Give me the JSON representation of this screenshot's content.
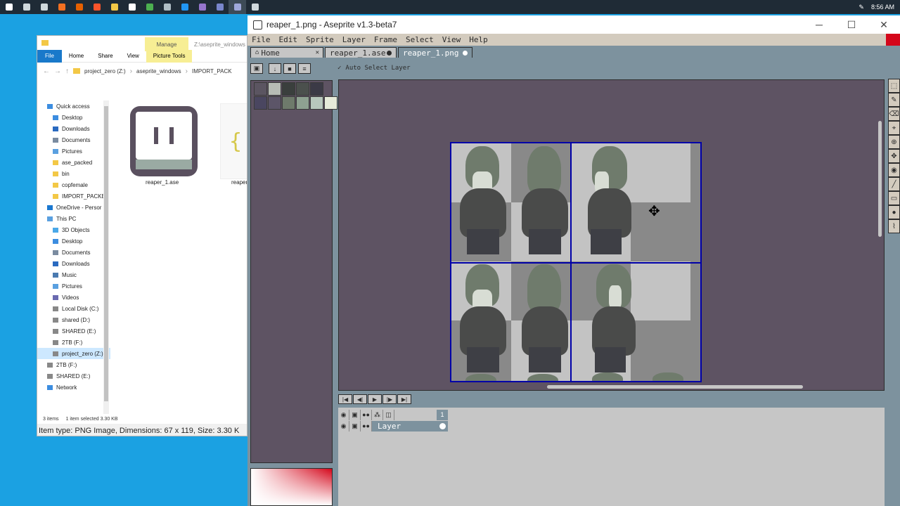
{
  "taskbar": {
    "icons": [
      "windows-icon",
      "search-icon",
      "taskview-icon",
      "search-app-icon",
      "firefox-icon",
      "brave-icon",
      "explorer-icon",
      "obs-icon",
      "app-icon",
      "app2-icon",
      "vscode-icon",
      "app3-icon",
      "app4-icon",
      "aseprite-icon",
      "app5-icon"
    ],
    "time": "8:56 AM"
  },
  "explorer": {
    "manage_label": "Manage",
    "path_small": "Z:\\aseprite_windows",
    "ribbon": {
      "file": "File",
      "home": "Home",
      "share": "Share",
      "view": "View",
      "picture_tools": "Picture Tools"
    },
    "address": {
      "drive": "project_zero (Z:)",
      "folder1": "aseprite_windows",
      "folder2": "IMPORT_PACK"
    },
    "nav": [
      {
        "label": "Quick access",
        "indent": 0,
        "color": "#3c8de0"
      },
      {
        "label": "Desktop",
        "indent": 1,
        "color": "#3c8de0"
      },
      {
        "label": "Downloads",
        "indent": 1,
        "color": "#2a6ac0"
      },
      {
        "label": "Documents",
        "indent": 1,
        "color": "#7a8ba0"
      },
      {
        "label": "Pictures",
        "indent": 1,
        "color": "#5aa0e0"
      },
      {
        "label": "ase_packed",
        "indent": 1,
        "color": "#f3c846"
      },
      {
        "label": "bin",
        "indent": 1,
        "color": "#f3c846"
      },
      {
        "label": "copfemale",
        "indent": 1,
        "color": "#f3c846"
      },
      {
        "label": "IMPORT_PACKE",
        "indent": 1,
        "color": "#f3c846"
      },
      {
        "label": "OneDrive - Persor",
        "indent": 0,
        "color": "#1b78d0"
      },
      {
        "label": "This PC",
        "indent": 0,
        "color": "#5aa0e0"
      },
      {
        "label": "3D Objects",
        "indent": 1,
        "color": "#4aa8e8"
      },
      {
        "label": "Desktop",
        "indent": 1,
        "color": "#3c8de0"
      },
      {
        "label": "Documents",
        "indent": 1,
        "color": "#7a8ba0"
      },
      {
        "label": "Downloads",
        "indent": 1,
        "color": "#2a6ac0"
      },
      {
        "label": "Music",
        "indent": 1,
        "color": "#4a7ab0"
      },
      {
        "label": "Pictures",
        "indent": 1,
        "color": "#5aa0e0"
      },
      {
        "label": "Videos",
        "indent": 1,
        "color": "#6a6ab0"
      },
      {
        "label": "Local Disk (C:)",
        "indent": 1,
        "color": "#888888"
      },
      {
        "label": "shared (D:)",
        "indent": 1,
        "color": "#888888"
      },
      {
        "label": "SHARED (E:)",
        "indent": 1,
        "color": "#888888"
      },
      {
        "label": "2TB (F:)",
        "indent": 1,
        "color": "#888888"
      },
      {
        "label": "project_zero (Z:)",
        "indent": 1,
        "color": "#888888",
        "selected": true
      },
      {
        "label": "2TB (F:)",
        "indent": 0,
        "color": "#888888"
      },
      {
        "label": "SHARED (E:)",
        "indent": 0,
        "color": "#888888"
      },
      {
        "label": "Network",
        "indent": 0,
        "color": "#3c8de0"
      }
    ],
    "files": [
      {
        "name": "reaper_1.ase"
      },
      {
        "name": "reaper"
      }
    ],
    "status": {
      "count": "3 items",
      "selected": "1 item selected  3.30 KB"
    },
    "item_type": "Item type: PNG Image, Dimensions: 67 x 119, Size: 3.30 K"
  },
  "aseprite": {
    "title": "reaper_1.png - Aseprite v1.3-beta7",
    "menu": [
      "File",
      "Edit",
      "Sprite",
      "Layer",
      "Frame",
      "Select",
      "View",
      "Help"
    ],
    "tabs": [
      {
        "label": "Home"
      },
      {
        "label": "reaper_1.ase"
      },
      {
        "label": "reaper_1.png"
      }
    ],
    "context": {
      "auto_select_label": "Auto Select Layer"
    },
    "palette": [
      "#5b5561",
      "#b7bcb5",
      "#3a3f3d",
      "#4b504d",
      "#3b3a46",
      "#4a4660",
      "#5c5568",
      "#6e7a6b",
      "#8ea191",
      "#b7c7bc",
      "#e6ebd9"
    ],
    "palette_marker": "II",
    "timeline": {
      "frame": "1",
      "layer": "Layer"
    },
    "tools": [
      "marquee-icon",
      "pencil-icon",
      "eraser-icon",
      "eyedropper-icon",
      "zoom-icon",
      "move-icon",
      "fill-icon",
      "line-icon",
      "rectangle-icon",
      "blur-icon",
      "smudge-icon"
    ]
  }
}
